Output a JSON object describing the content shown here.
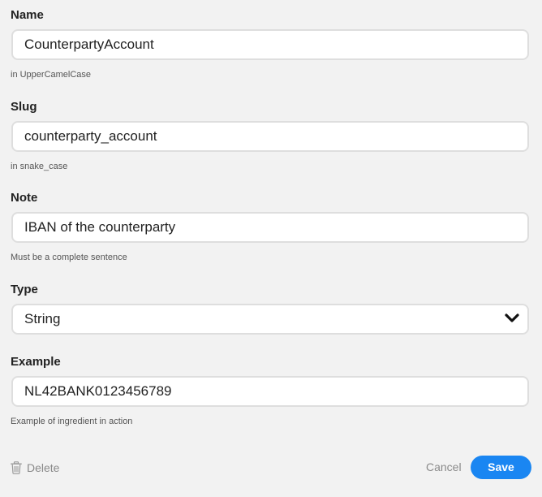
{
  "fields": {
    "name": {
      "label": "Name",
      "value": "CounterpartyAccount",
      "hint": "in UpperCamelCase"
    },
    "slug": {
      "label": "Slug",
      "value": "counterparty_account",
      "hint": "in snake_case"
    },
    "note": {
      "label": "Note",
      "value": "IBAN of the counterparty",
      "hint": "Must be a complete sentence"
    },
    "type": {
      "label": "Type",
      "value": "String",
      "icon": "chevron-down-icon"
    },
    "example": {
      "label": "Example",
      "value": "NL42BANK0123456789",
      "hint": "Example of ingredient in action"
    }
  },
  "footer": {
    "delete_label": "Delete",
    "delete_icon": "trash-icon",
    "cancel_label": "Cancel",
    "save_label": "Save"
  },
  "colors": {
    "background": "#f2f2f2",
    "accent": "#1a86f2",
    "muted_text": "#8a8a8a"
  }
}
